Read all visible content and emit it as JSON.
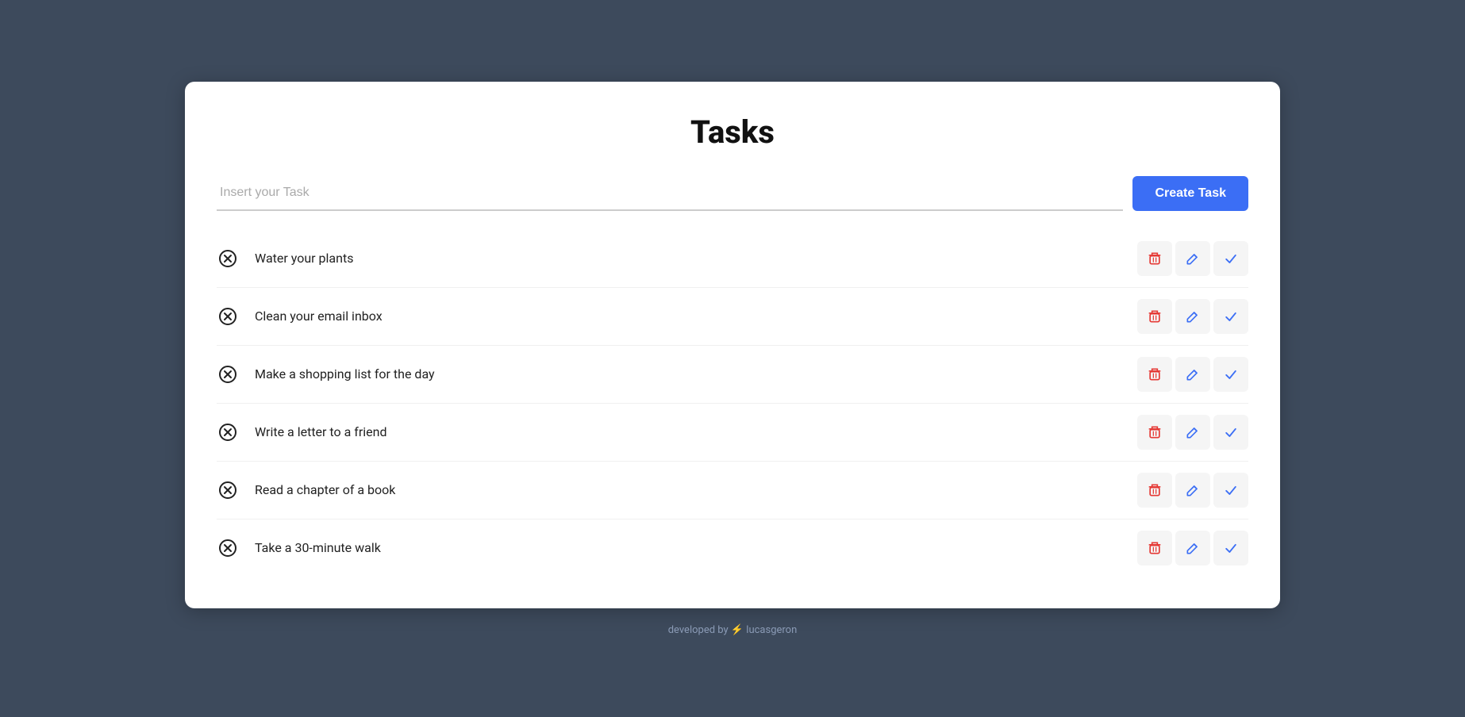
{
  "app": {
    "title": "Tasks",
    "input_placeholder": "Insert your Task",
    "create_button_label": "Create Task"
  },
  "tasks": [
    {
      "id": 1,
      "text": "Water your plants"
    },
    {
      "id": 2,
      "text": "Clean your email inbox"
    },
    {
      "id": 3,
      "text": "Make a shopping list for the day"
    },
    {
      "id": 4,
      "text": "Write a letter to a friend"
    },
    {
      "id": 5,
      "text": "Read a chapter of a book"
    },
    {
      "id": 6,
      "text": "Take a 30-minute walk"
    }
  ],
  "footer": {
    "text": "developed by",
    "author": "lucasgeron"
  }
}
